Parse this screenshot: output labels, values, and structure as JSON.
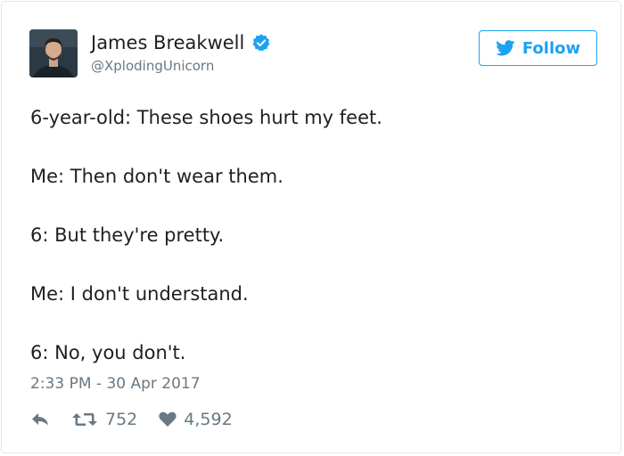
{
  "author": {
    "display_name": "James Breakwell",
    "handle": "@XplodingUnicorn",
    "verified": true,
    "avatar_icon": "person-photo-avatar"
  },
  "follow_button": {
    "label": "Follow",
    "icon": "twitter-bird-icon"
  },
  "tweet": {
    "lines": [
      "6-year-old: These shoes hurt my feet.",
      "Me: Then don't wear them.",
      "6: But they're pretty.",
      "Me: I don't understand.",
      "6: No, you don't."
    ],
    "timestamp": "2:33 PM - 30 Apr 2017"
  },
  "actions": {
    "reply_icon": "reply-icon",
    "retweet_icon": "retweet-icon",
    "retweet_count": "752",
    "like_icon": "heart-icon",
    "like_count": "4,592"
  },
  "colors": {
    "accent": "#1da1f2",
    "text": "#1c2022",
    "muted": "#697882",
    "border": "#e1e8ed"
  }
}
